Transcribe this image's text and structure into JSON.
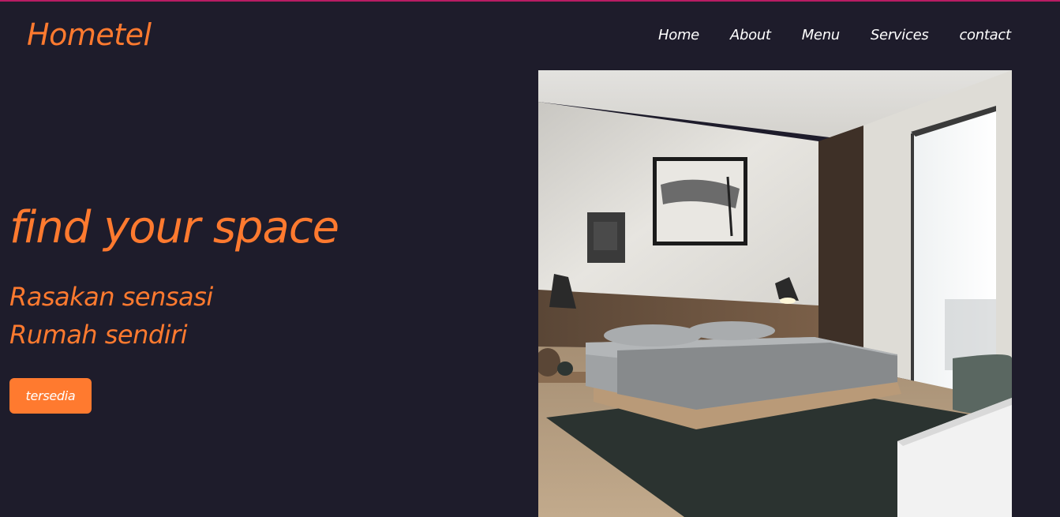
{
  "brand": {
    "name": "Hometel"
  },
  "nav": {
    "items": [
      "Home",
      "About",
      "Menu",
      "Services",
      "contact"
    ]
  },
  "hero": {
    "title": "find your space",
    "subtitle_line1": "Rasakan sensasi",
    "subtitle_line2": "Rumah sendiri",
    "cta_label": "tersedia"
  },
  "colors": {
    "background": "#1e1c2b",
    "accent": "#ff7a2f",
    "top_border": "#b81c63",
    "nav_text": "#ffffff"
  }
}
